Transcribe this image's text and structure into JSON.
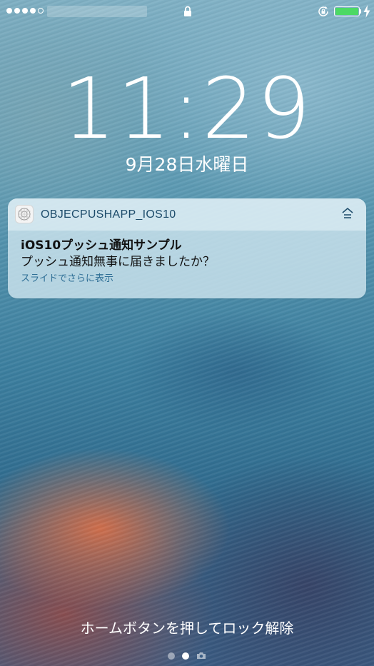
{
  "status_bar": {
    "signal_bars_filled": 4,
    "signal_bars_total": 5,
    "lock_icon": "lock-icon",
    "rotation_lock_icon": "rotation-lock-icon",
    "battery_level": 1.0,
    "battery_color": "#4cd964",
    "charging_icon": "bolt-icon"
  },
  "lock_screen": {
    "time": "11:29",
    "date": "9月28日水曜日",
    "unlock_hint": "ホームボタンを押してロック解除"
  },
  "notification": {
    "app_name": "OBJECPUSHAPP_IOS10",
    "expand_icon": "chevron-expand-icon",
    "title": "iOS10プッシュ通知サンプル",
    "message": "プッシュ通知無事に届きましたか？",
    "hint": "スライドでさらに表示",
    "app_name_color": "#1c4b6a",
    "hint_color": "#2f6f96"
  },
  "page_indicator": {
    "pages": 2,
    "active_index": 1,
    "camera_icon": "camera-icon"
  }
}
